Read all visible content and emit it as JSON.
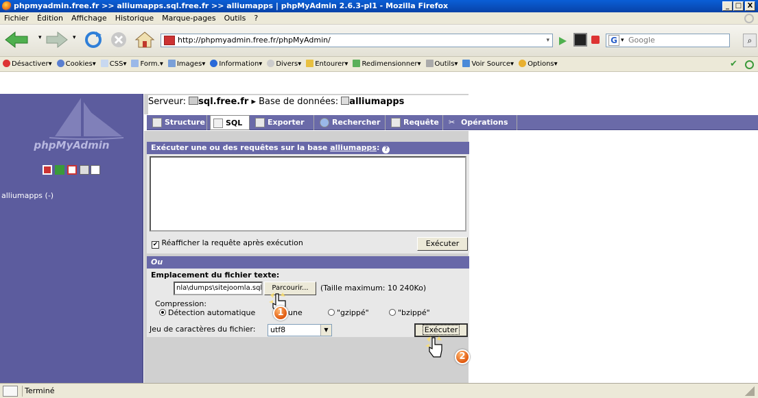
{
  "window": {
    "title": "phpmyadmin.free.fr >> alliumapps.sql.free.fr >> alliumapps | phpMyAdmin 2.6.3-pl1 - Mozilla Firefox",
    "min": "_",
    "max": "□",
    "close": "X"
  },
  "menu": [
    "Fichier",
    "Édition",
    "Affichage",
    "Historique",
    "Marque-pages",
    "Outils",
    "?"
  ],
  "nav": {
    "url": "http://phpmyadmin.free.fr/phpMyAdmin/",
    "search_placeholder": "Google"
  },
  "extbar": [
    "Désactiver▾",
    "Cookies▾",
    "CSS▾",
    "Form.▾",
    "Images▾",
    "Information▾",
    "Divers▾",
    "Entourer▾",
    "Redimensionner▾",
    "Outils▾",
    "Voir Source▾",
    "Options▾"
  ],
  "sidebar": {
    "logo": "phpMyAdmin",
    "db_link": "alliumapps (-)"
  },
  "breadcrumb": {
    "server_label": "Serveur:",
    "server": "sql.free.fr",
    "sep": "▸",
    "db_label": "Base de données:",
    "db": "alliumapps"
  },
  "tabs": [
    "Structure",
    "SQL",
    "Exporter",
    "Rechercher",
    "Requête",
    "Opérations"
  ],
  "sql_panel": {
    "header": "Exécuter une ou des requêtes sur la base ",
    "header_db": "alliumapps",
    "header_suffix": ":",
    "checkbox_label": "Réafficher la requête après exécution",
    "run": "Exécuter"
  },
  "file_panel": {
    "or": "Ou",
    "location_label": "Emplacement du fichier texte:",
    "file_value": "nla\\dumps\\sitejoomla.sql",
    "browse": "Parcourir...",
    "max_size": "(Taille maximum: 10 240Ko)",
    "compression_label": "Compression:",
    "opt_auto": "Détection automatique",
    "opt_none": "une",
    "opt_gzip": "\"gzippé\"",
    "opt_bzip": "\"bzippé\"",
    "charset_label": "Jeu de caractères du fichier:",
    "charset": "utf8",
    "run": "Exécuter"
  },
  "annotations": {
    "badge1": "1",
    "badge2": "2"
  },
  "status": {
    "text": "Terminé"
  },
  "colors": {
    "panel_header": "#6868a8",
    "sidebar": "#5c5c9e",
    "tabbar": "#6a6aa8"
  }
}
